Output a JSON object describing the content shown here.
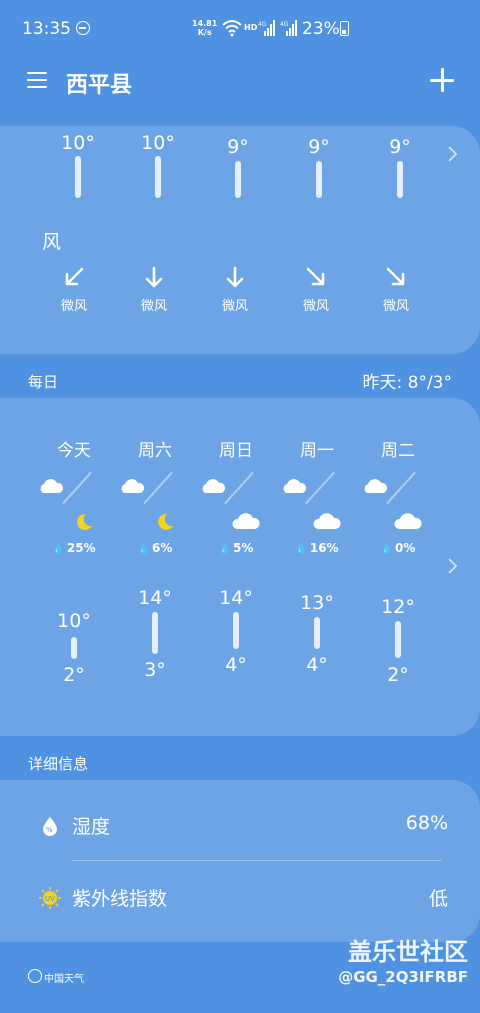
{
  "status_bar": {
    "time": "13:35",
    "net_speed": "14.81",
    "net_speed_unit": "K/s",
    "hd": "HD",
    "battery": "23%"
  },
  "header": {
    "city": "西平县"
  },
  "hourly": {
    "temps": [
      "10°",
      "10°",
      "9°",
      "9°",
      "9°"
    ],
    "wind_title": "风",
    "wind_dirs": [
      "southwest",
      "south",
      "south",
      "southeast",
      "southeast"
    ],
    "wind_labels": [
      "微风",
      "微风",
      "微风",
      "微风",
      "微风"
    ]
  },
  "daily_label": "每日",
  "yesterday": "昨天: 8°/3°",
  "daily": [
    {
      "day": "今天",
      "day_icon": "cloud-icon",
      "night_icon": "moon-icon",
      "rain": "25%",
      "high": "10°",
      "low": "2°"
    },
    {
      "day": "周六",
      "day_icon": "cloud-icon",
      "night_icon": "moon-icon",
      "rain": "6%",
      "high": "14°",
      "low": "3°"
    },
    {
      "day": "周日",
      "day_icon": "cloud-icon",
      "night_icon": "cloud-icon",
      "rain": "5%",
      "high": "14°",
      "low": "4°"
    },
    {
      "day": "周一",
      "day_icon": "cloud-icon",
      "night_icon": "cloud-icon",
      "rain": "16%",
      "high": "13°",
      "low": "4°"
    },
    {
      "day": "周二",
      "day_icon": "cloud-icon",
      "night_icon": "cloud-icon",
      "rain": "0%",
      "high": "12°",
      "low": "2°"
    }
  ],
  "details_label": "详细信息",
  "details": {
    "humidity_label": "湿度",
    "humidity_value": "68%",
    "uv_label": "紫外线指数",
    "uv_value": "低"
  },
  "footer": {
    "logo_text": "中国天气",
    "watermark": "盖乐世社区",
    "credit": "@GG_2Q3IFRBF"
  },
  "colors": {
    "background": "#4f92e1",
    "card": "rgba(255,255,255,0.17)"
  }
}
